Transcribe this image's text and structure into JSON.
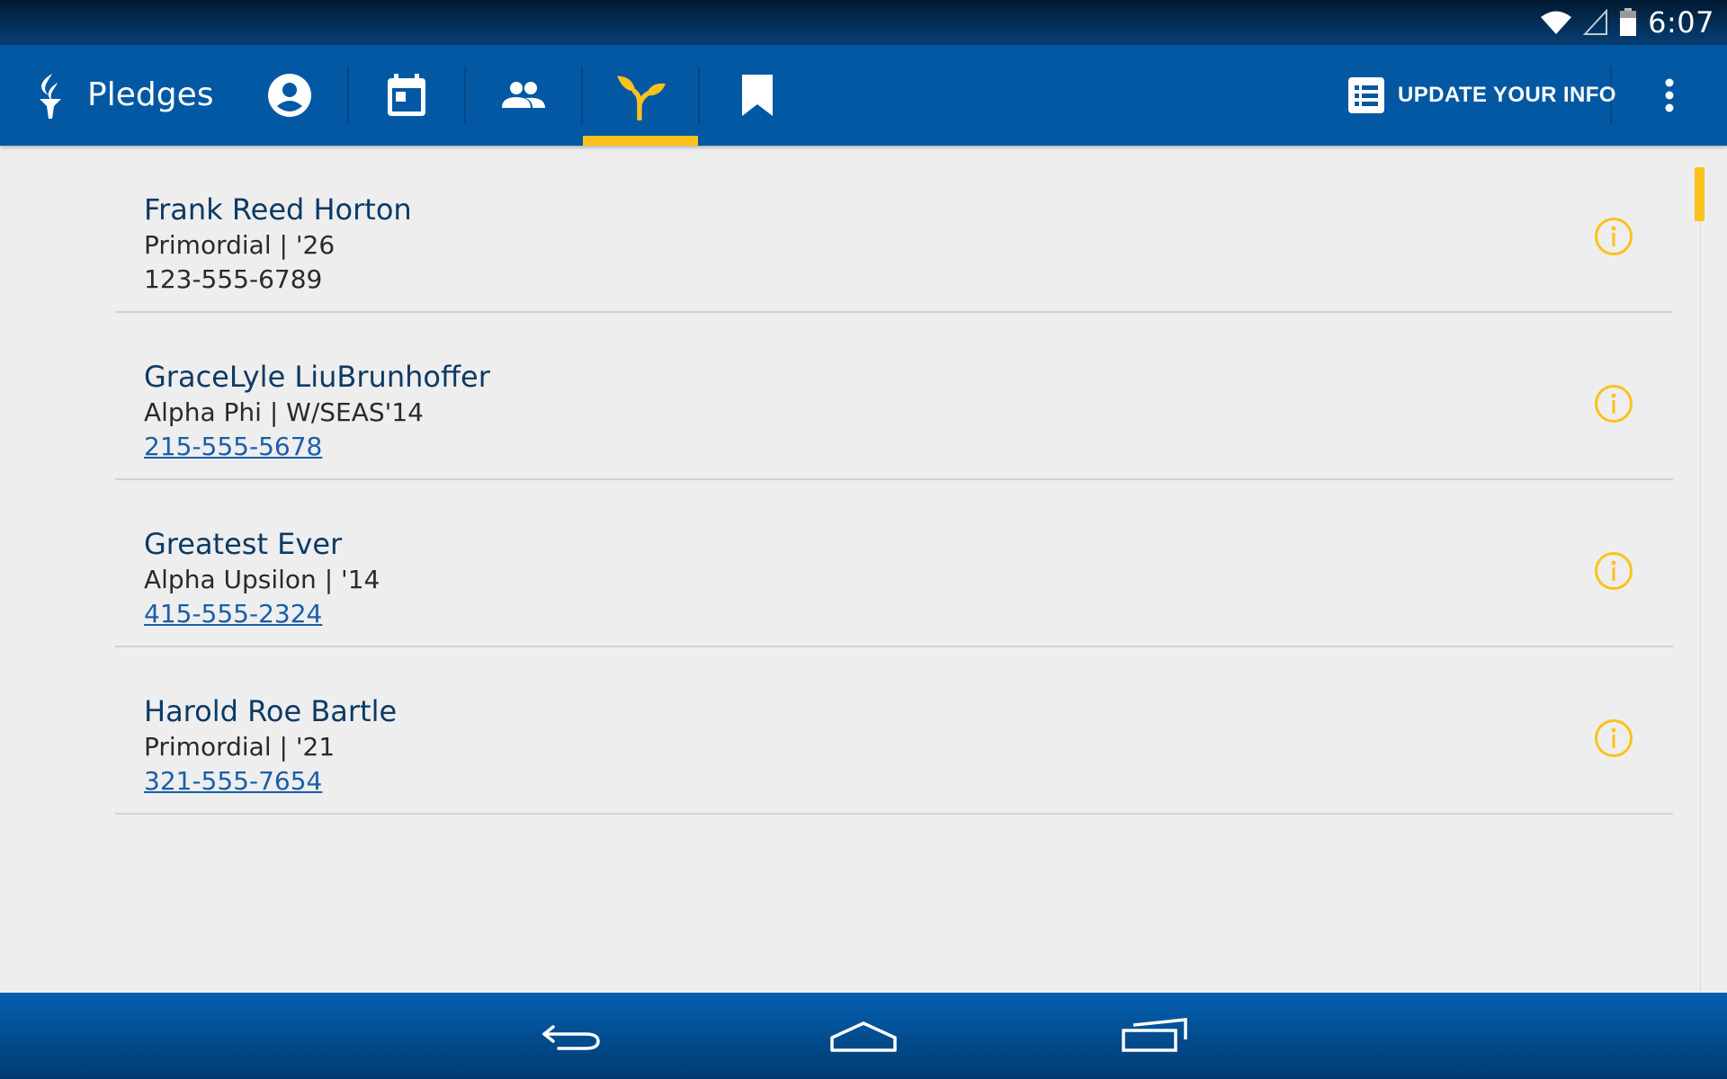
{
  "status_bar": {
    "time": "6:07",
    "icons": [
      "wifi-icon",
      "cell-signal-icon",
      "battery-icon"
    ]
  },
  "app_bar": {
    "title": "Pledges",
    "logo": "torch-logo",
    "tabs": [
      {
        "icon": "account-circle-icon",
        "selected": false
      },
      {
        "icon": "calendar-icon",
        "selected": false
      },
      {
        "icon": "people-icon",
        "selected": false
      },
      {
        "icon": "sprout-icon",
        "selected": true
      },
      {
        "icon": "bookmark-icon",
        "selected": false
      }
    ],
    "update_button_label": "UPDATE YOUR INFO",
    "update_button_icon": "list-icon",
    "menu_icon": "more-vert-icon"
  },
  "pledges": [
    {
      "name": "Frank Reed Horton",
      "org": "Primordial | '26",
      "phone": "123-555-6789",
      "phone_link": false
    },
    {
      "name": "GraceLyle LiuBrunhoffer",
      "org": "Alpha Phi | W/SEAS'14",
      "phone": "215-555-5678",
      "phone_link": true
    },
    {
      "name": "Greatest Ever",
      "org": "Alpha Upsilon | '14",
      "phone": "415-555-2324",
      "phone_link": true
    },
    {
      "name": "Harold Roe Bartle",
      "org": "Primordial | '21",
      "phone": "321-555-7654",
      "phone_link": true
    }
  ],
  "colors": {
    "primary": "#0358a4",
    "accent": "#fbc21b",
    "background": "#eeeeee",
    "name_text": "#0c3a66",
    "link": "#1a5ea8"
  },
  "nav_bar": {
    "buttons": [
      "back-icon",
      "home-icon",
      "recent-apps-icon"
    ]
  }
}
